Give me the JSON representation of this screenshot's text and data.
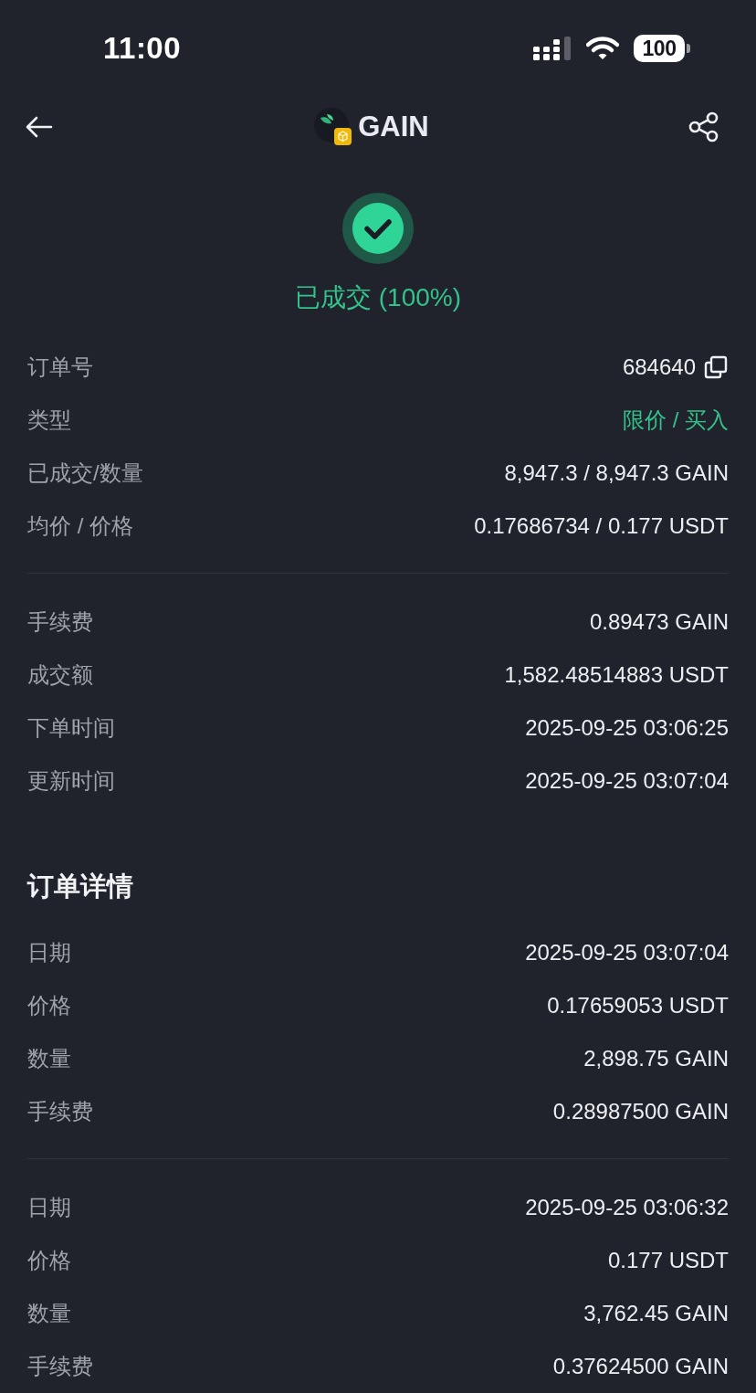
{
  "status_bar": {
    "time": "11:00",
    "battery": "100"
  },
  "nav": {
    "title": "GAIN"
  },
  "status": {
    "label": "已成交 (100%)"
  },
  "order": [
    {
      "label": "订单号",
      "value": "684640",
      "kind": "copy"
    },
    {
      "label": "类型",
      "value": "限价 / 买入",
      "kind": "accent"
    },
    {
      "label": "已成交/数量",
      "value": "8,947.3 / 8,947.3 GAIN",
      "kind": "plain"
    },
    {
      "label": "均价 / 价格",
      "value": "0.17686734 / 0.177 USDT",
      "kind": "plain"
    }
  ],
  "totals": [
    {
      "label": "手续费",
      "value": "0.89473 GAIN"
    },
    {
      "label": "成交额",
      "value": "1,582.48514883 USDT"
    },
    {
      "label": "下单时间",
      "value": "2025-09-25 03:06:25"
    },
    {
      "label": "更新时间",
      "value": "2025-09-25 03:07:04"
    }
  ],
  "details": {
    "title": "订单详情",
    "trades": [
      {
        "rows": [
          {
            "label": "日期",
            "value": "2025-09-25 03:07:04"
          },
          {
            "label": "价格",
            "value": "0.17659053 USDT"
          },
          {
            "label": "数量",
            "value": "2,898.75 GAIN"
          },
          {
            "label": "手续费",
            "value": "0.28987500 GAIN"
          }
        ]
      },
      {
        "rows": [
          {
            "label": "日期",
            "value": "2025-09-25 03:06:32"
          },
          {
            "label": "价格",
            "value": "0.177 USDT"
          },
          {
            "label": "数量",
            "value": "3,762.45 GAIN"
          },
          {
            "label": "手续费",
            "value": "0.37624500 GAIN"
          }
        ]
      }
    ]
  }
}
